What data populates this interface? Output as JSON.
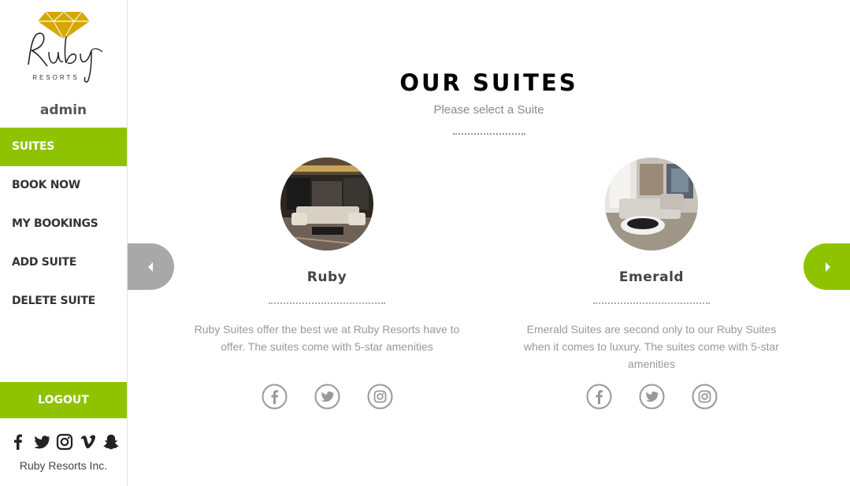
{
  "sidebar": {
    "logo": {
      "wordmark": "Ruby",
      "tagline": "RESORTS"
    },
    "username": "admin",
    "nav": [
      {
        "label": "SUITES",
        "active": true
      },
      {
        "label": "BOOK NOW",
        "active": false
      },
      {
        "label": "MY BOOKINGS",
        "active": false
      },
      {
        "label": "ADD SUITE",
        "active": false
      },
      {
        "label": "DELETE SUITE",
        "active": false
      }
    ],
    "logout_label": "LOGOUT",
    "social_icons": [
      "facebook-icon",
      "twitter-icon",
      "instagram-icon",
      "vimeo-icon",
      "snapchat-icon"
    ],
    "copyright": "Ruby Resorts Inc."
  },
  "main": {
    "title": "OUR SUITES",
    "subtitle": "Please select a Suite",
    "suites": [
      {
        "name": "Ruby",
        "description": "Ruby Suites offer the best we at Ruby Resorts have to offer. The suites come with 5-star amenities",
        "social_icons": [
          "facebook-icon",
          "twitter-icon",
          "instagram-icon"
        ]
      },
      {
        "name": "Emerald",
        "description": "Emerald Suites are second only to our Ruby Suites when it comes to luxury. The suites come with 5-star amenities",
        "social_icons": [
          "facebook-icon",
          "twitter-icon",
          "instagram-icon"
        ]
      }
    ],
    "carousel": {
      "prev_icon": "caret-left-icon",
      "next_icon": "caret-right-icon"
    }
  },
  "colors": {
    "accent": "#8fc300",
    "logo_gem": "#d4a800",
    "muted_text": "#999999",
    "arrow_inactive": "#a8a8a8"
  }
}
